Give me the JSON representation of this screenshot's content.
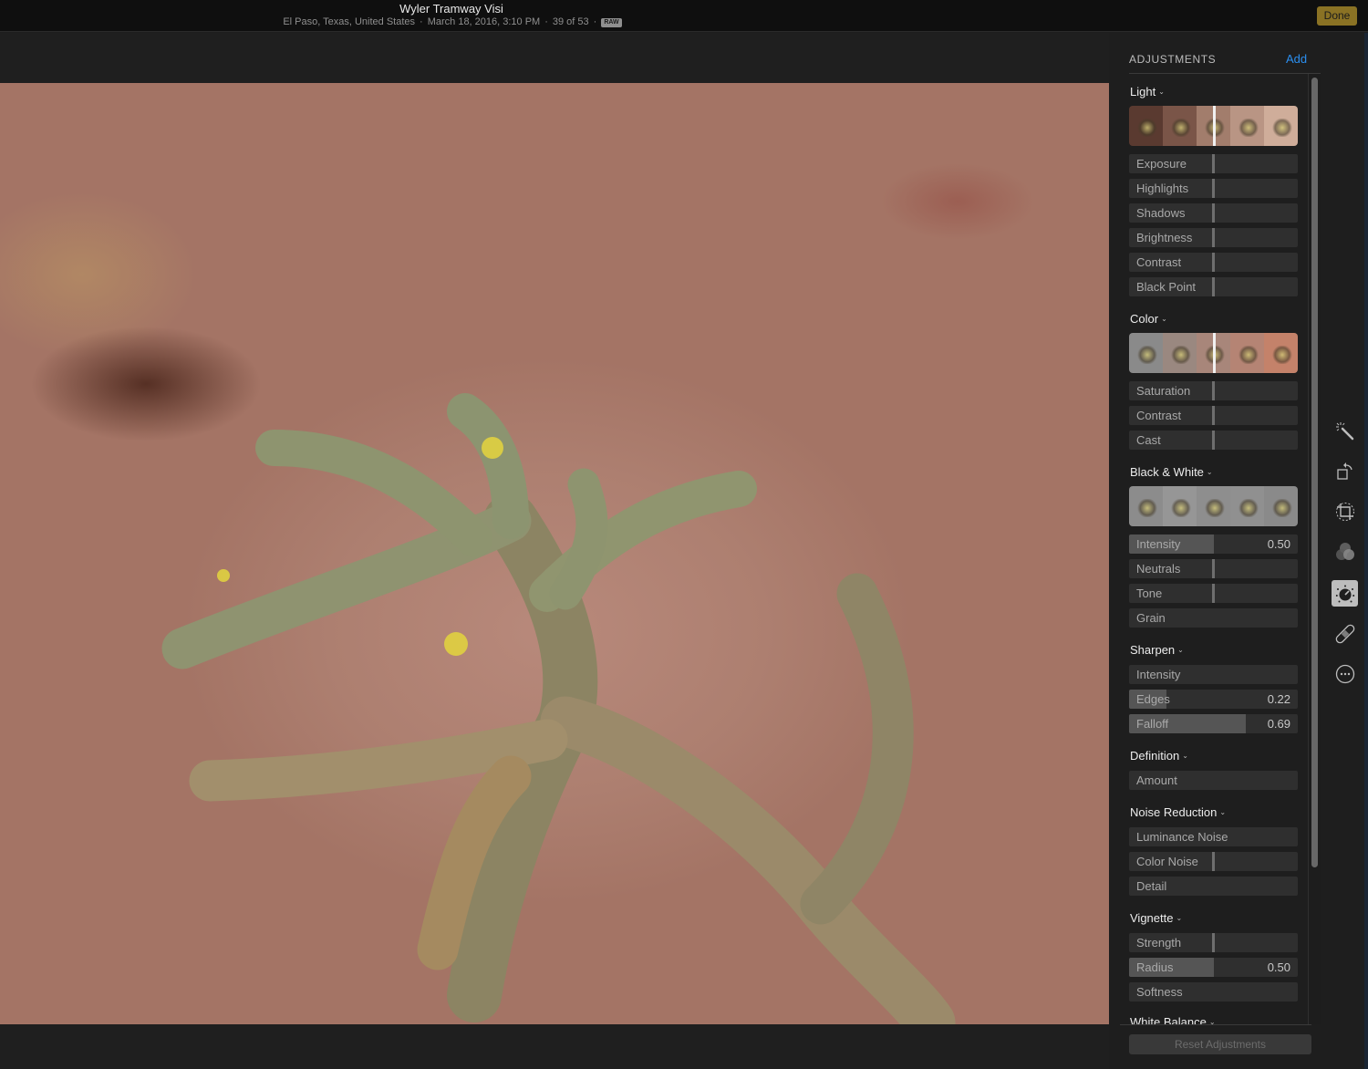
{
  "titlebar": {
    "title": "Wyler Tramway Visi",
    "location": "El Paso, Texas, United States",
    "datetime": "March 18, 2016, 3:10 PM",
    "position": "39 of 53",
    "separator": "·",
    "format_badge": "RAW",
    "done_label": "Done"
  },
  "colors": {
    "done_button": "#8a7224",
    "accent_link": "#2b8ff0",
    "background": "#1e1e1e"
  },
  "adjustments": {
    "header": "ADJUSTMENTS",
    "add_label": "Add",
    "sections": [
      {
        "title": "Light",
        "sliders": [
          {
            "label": "Exposure",
            "value": ""
          },
          {
            "label": "Highlights",
            "value": ""
          },
          {
            "label": "Shadows",
            "value": ""
          },
          {
            "label": "Brightness",
            "value": ""
          },
          {
            "label": "Contrast",
            "value": ""
          },
          {
            "label": "Black Point",
            "value": ""
          }
        ]
      },
      {
        "title": "Color",
        "sliders": [
          {
            "label": "Saturation",
            "value": ""
          },
          {
            "label": "Contrast",
            "value": ""
          },
          {
            "label": "Cast",
            "value": ""
          }
        ]
      },
      {
        "title": "Black & White",
        "sliders": [
          {
            "label": "Intensity",
            "value": "0.50",
            "fill": 0.5
          },
          {
            "label": "Neutrals",
            "value": ""
          },
          {
            "label": "Tone",
            "value": ""
          },
          {
            "label": "Grain",
            "value": ""
          }
        ]
      },
      {
        "title": "Sharpen",
        "sliders": [
          {
            "label": "Intensity",
            "value": ""
          },
          {
            "label": "Edges",
            "value": "0.22",
            "fill": 0.22
          },
          {
            "label": "Falloff",
            "value": "0.69",
            "fill": 0.69
          }
        ]
      },
      {
        "title": "Definition",
        "sliders": [
          {
            "label": "Amount",
            "value": ""
          }
        ]
      },
      {
        "title": "Noise Reduction",
        "sliders": [
          {
            "label": "Luminance Noise",
            "value": ""
          },
          {
            "label": "Color Noise",
            "value": ""
          },
          {
            "label": "Detail",
            "value": ""
          }
        ]
      },
      {
        "title": "Vignette",
        "sliders": [
          {
            "label": "Strength",
            "value": ""
          },
          {
            "label": "Radius",
            "value": "0.50",
            "fill": 0.5
          },
          {
            "label": "Softness",
            "value": ""
          }
        ]
      },
      {
        "title": "White Balance",
        "sliders": []
      }
    ],
    "reset_label": "Reset Adjustments"
  },
  "tools": [
    {
      "name": "enhance-tool",
      "icon": "magic-wand-icon",
      "active": false
    },
    {
      "name": "rotate-tool",
      "icon": "rotate-icon",
      "active": false
    },
    {
      "name": "crop-tool",
      "icon": "crop-icon",
      "active": false
    },
    {
      "name": "filters-tool",
      "icon": "filters-icon",
      "active": false
    },
    {
      "name": "adjust-tool",
      "icon": "adjust-dial-icon",
      "active": true
    },
    {
      "name": "retouch-tool",
      "icon": "bandage-icon",
      "active": false
    },
    {
      "name": "extensions-tool",
      "icon": "more-icon",
      "active": false
    }
  ]
}
